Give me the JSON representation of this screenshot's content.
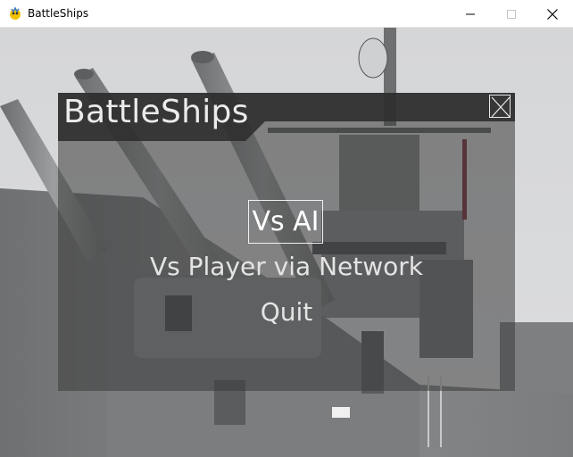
{
  "window": {
    "title": "BattleShips",
    "icon": "pygame-snake-icon",
    "controls": [
      "minimize-icon",
      "maximize-icon",
      "close-icon"
    ]
  },
  "menu": {
    "title": "BattleShips",
    "close_icon": "close-box-icon",
    "items": [
      {
        "label": "Vs AI",
        "selected": true
      },
      {
        "label": "Vs Player via Network",
        "selected": false
      },
      {
        "label": "Quit",
        "selected": false
      }
    ]
  },
  "colors": {
    "sky": "#d8d9db",
    "ship": "#7c7e7f",
    "panel_overlay": "#3a3a3a",
    "title_bar": "#2f2f2f",
    "text": "#e4e4e4"
  }
}
